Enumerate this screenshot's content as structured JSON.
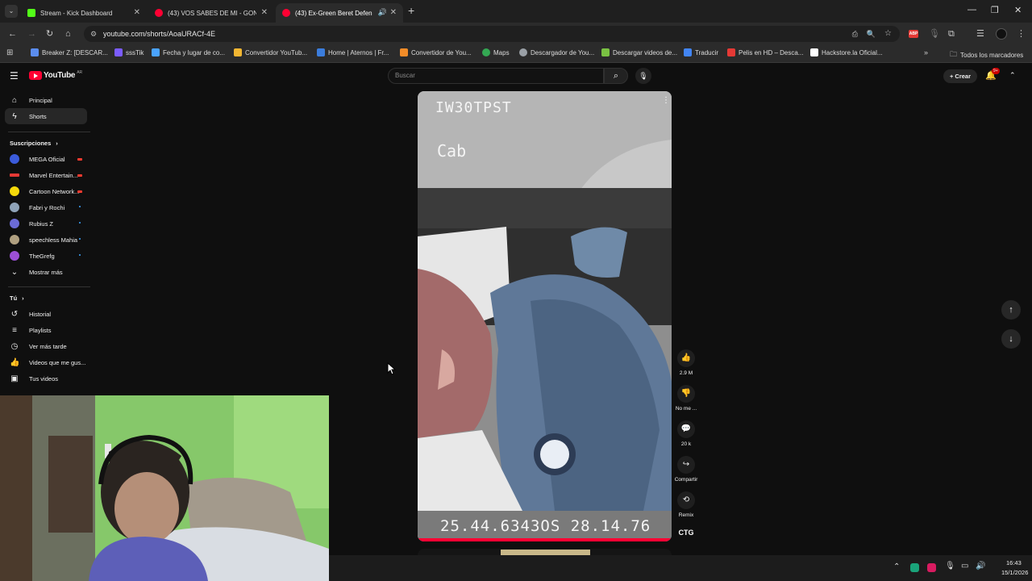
{
  "browser": {
    "tabs": [
      {
        "title": "Stream - Kick Dashboard",
        "color": "#53fc18",
        "active": false
      },
      {
        "title": "(43) VOS SABES DE MI - GONZ",
        "color": "#ff0033",
        "active": false
      },
      {
        "title": "(43) Ex-Green Beret Defend",
        "color": "#ff0033",
        "active": true
      }
    ],
    "url": "youtube.com/shorts/AoaURACf-4E",
    "bookmarks": [
      {
        "label": "Breaker Z: [DESCAR...",
        "color": "#5b8def"
      },
      {
        "label": "sssTik",
        "color": "#7b5cff"
      },
      {
        "label": "Fecha y lugar de co...",
        "color": "#4aa3ff"
      },
      {
        "label": "Convertidor YouTub...",
        "color": "#f2b632"
      },
      {
        "label": "Home | Aternos | Fr...",
        "color": "#3b7ddd"
      },
      {
        "label": "Convertidor de You...",
        "color": "#f28c28"
      },
      {
        "label": "Maps",
        "color": "#34a853"
      },
      {
        "label": "Descargador de You...",
        "color": "#9aa0a6"
      },
      {
        "label": "Descargar videos de...",
        "color": "#7ac143"
      },
      {
        "label": "Traducir",
        "color": "#4285f4"
      },
      {
        "label": "Pelis en HD – Desca...",
        "color": "#e53935"
      },
      {
        "label": "Hackstore.la Oficial...",
        "color": "#ffffff"
      }
    ],
    "all_bookmarks": "Todos los marcadores"
  },
  "youtube": {
    "logo": "YouTube",
    "region": "AR",
    "search_placeholder": "Buscar",
    "create_label": "Crear",
    "notif_count": "9+",
    "nav": [
      {
        "label": "Principal",
        "icon": "home-icon"
      },
      {
        "label": "Shorts",
        "icon": "shorts-icon"
      }
    ],
    "subs_title": "Suscripciones",
    "subscriptions": [
      {
        "label": "MEGA Oficial",
        "color": "#3b5bdb",
        "dot": "#ff3b30"
      },
      {
        "label": "Marvel Entertain...",
        "color": "#e53935",
        "dot": "#ff3b30"
      },
      {
        "label": "Cartoon Network...",
        "color": "#f5d90a",
        "dot": "#ff3b30"
      },
      {
        "label": "Fabri y Rochi",
        "color": "#8fa3b8",
        "dot": "#3ea6ff"
      },
      {
        "label": "Rubius Z",
        "color": "#6b6bd6",
        "dot": "#3ea6ff"
      },
      {
        "label": "speechless Mahia",
        "color": "#b0a080",
        "dot": "#3ea6ff"
      },
      {
        "label": "TheGrefg",
        "color": "#9c4fd6",
        "dot": "#3ea6ff"
      }
    ],
    "show_more": "Mostrar más",
    "you_title": "Tú",
    "you_items": [
      {
        "label": "Historial",
        "icon": "history-icon"
      },
      {
        "label": "Playlists",
        "icon": "playlists-icon"
      },
      {
        "label": "Ver más tarde",
        "icon": "clock-icon"
      },
      {
        "label": "Videos que me gus...",
        "icon": "like-icon"
      },
      {
        "label": "Tus videos",
        "icon": "video-icon"
      }
    ],
    "video": {
      "overlay_top": "IW30TPST",
      "overlay_cab": "Cab",
      "overlay_bottom": "25.44.6343OS 28.14.76"
    },
    "actions": {
      "likes": "2.9 M",
      "dislike": "No me ...",
      "comments": "20 k",
      "share": "Compartir",
      "remix": "Remix",
      "channel": "CTG"
    }
  },
  "taskbar": {
    "time": "16:43",
    "date": "15/1/2026"
  }
}
